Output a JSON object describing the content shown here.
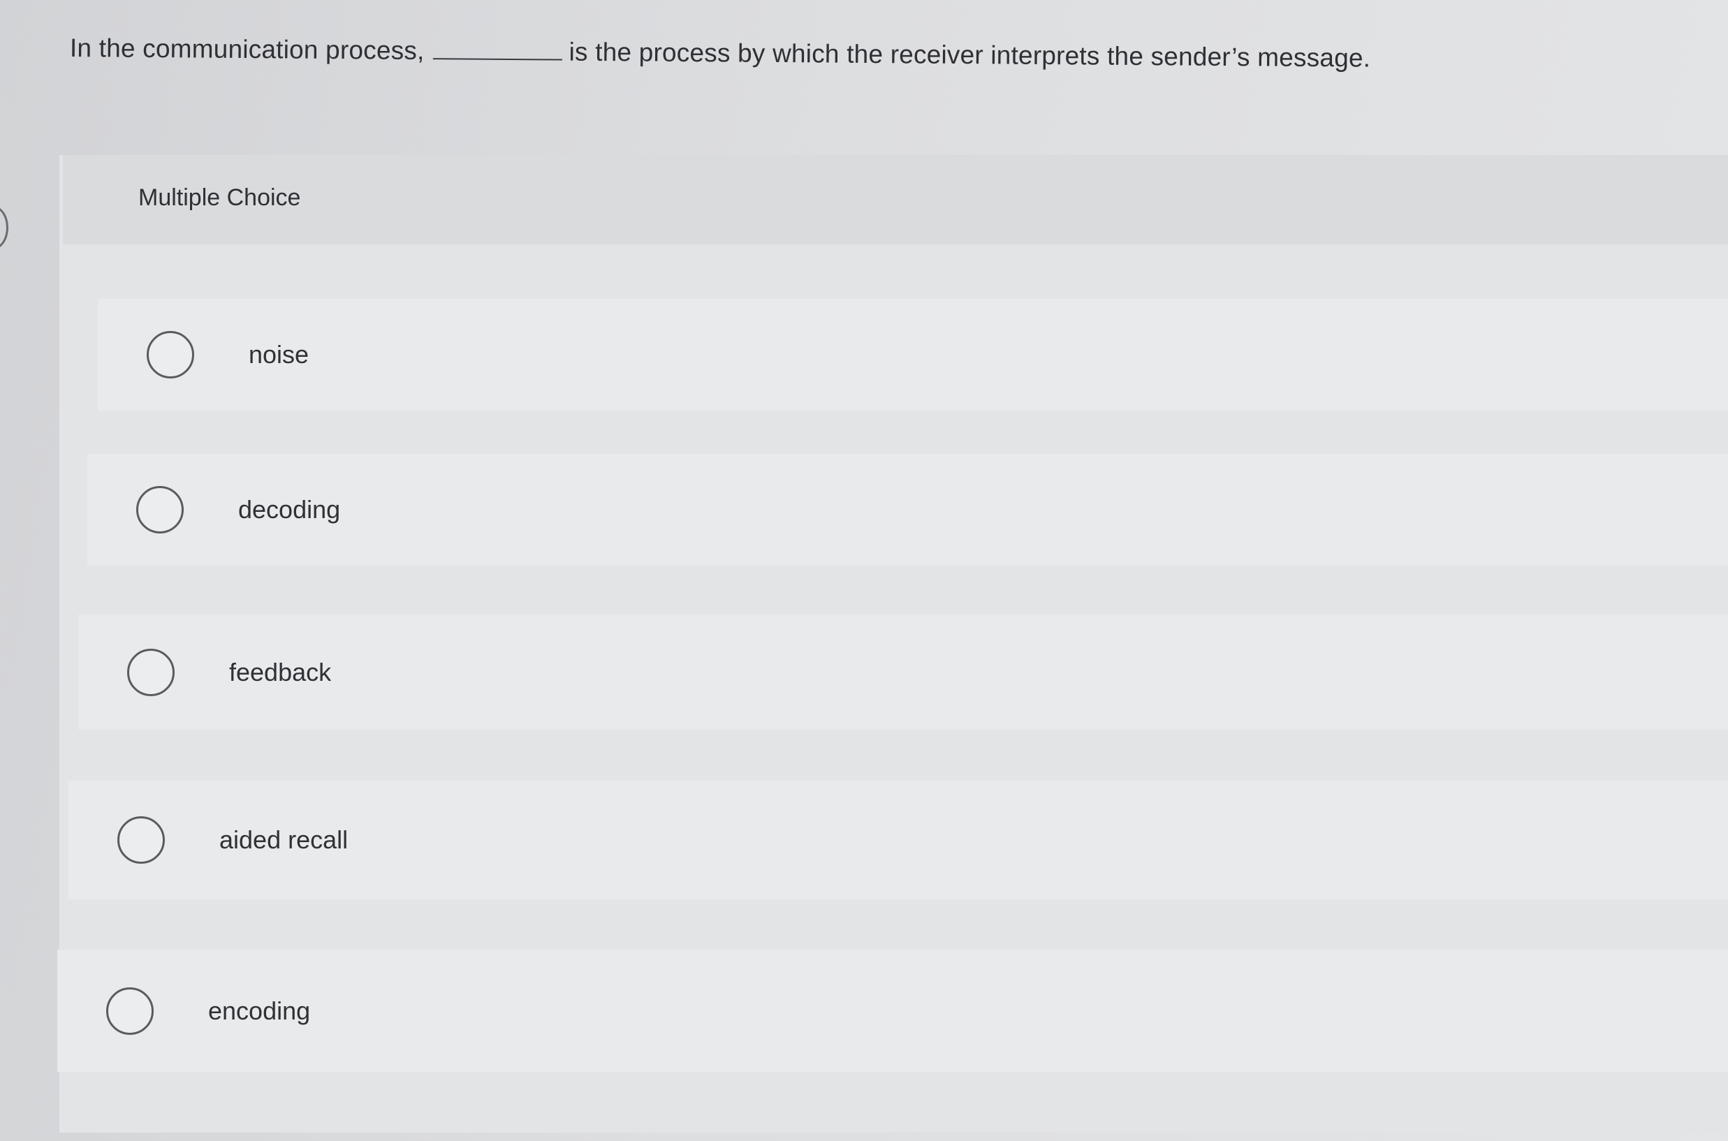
{
  "question": {
    "before_blank": "In the communication process,",
    "after_blank": "is the process by which the receiver interprets the sender’s message."
  },
  "section_label": "Multiple Choice",
  "options": [
    {
      "label": "noise"
    },
    {
      "label": "decoding"
    },
    {
      "label": "feedback"
    },
    {
      "label": "aided recall"
    },
    {
      "label": "encoding"
    }
  ],
  "colors": {
    "background": "#dddee0",
    "option_background": "#e9eaeb",
    "text": "#2f3035"
  }
}
